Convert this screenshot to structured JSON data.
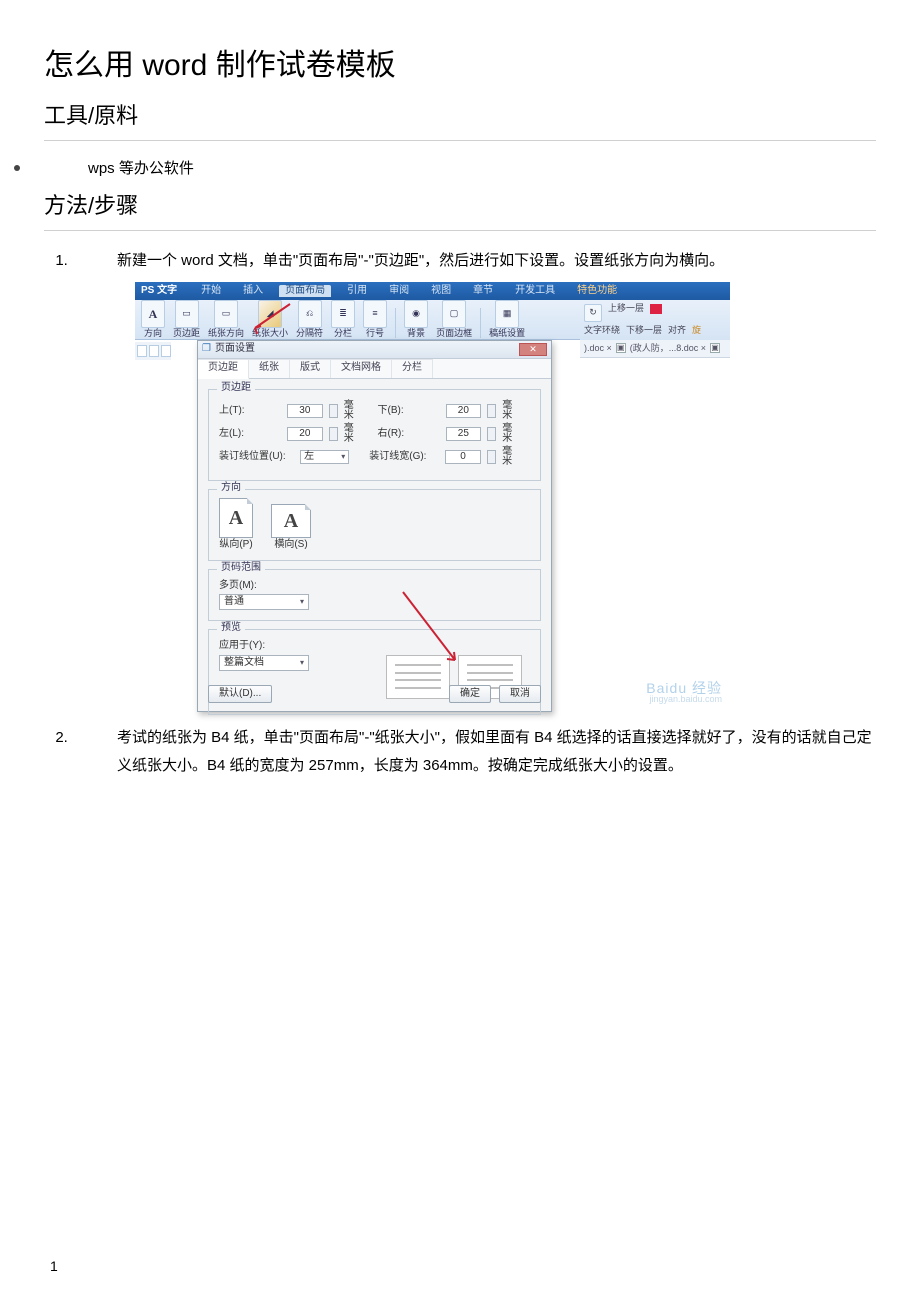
{
  "title": "怎么用 word 制作试卷模板",
  "sections": {
    "tools_head": "工具/原料",
    "tools_item": "wps 等办公软件",
    "steps_head": "方法/步骤"
  },
  "steps": {
    "s1": "新建一个 word 文档，单击\"页面布局\"-\"页边距\"，然后进行如下设置。设置纸张方向为横向。",
    "s2": "考试的纸张为 B4 纸，单击\"页面布局\"-\"纸张大小\"，假如里面有 B4 纸选择的话直接选择就好了，没有的话就自己定义纸张大小。B4 纸的宽度为 257mm，长度为 364mm。按确定完成纸张大小的设置。"
  },
  "ribbon": {
    "app": "PS 文字",
    "tabs": [
      "开始",
      "插入",
      "页面布局",
      "引用",
      "审阅",
      "视图",
      "章节",
      "开发工具",
      "特色功能"
    ],
    "active_tab": "页面布局",
    "groups": [
      "方向",
      "页边距",
      "纸张方向",
      "纸张大小",
      "分隔符",
      "分栏",
      "行号",
      "背景",
      "页面边框",
      "稿纸设置",
      "文字环绕",
      "上移一层",
      "下移一层",
      "对齐",
      "旋"
    ]
  },
  "doctabs": {
    "left": ").doc ×",
    "mid": "(政人防，...8.doc ×"
  },
  "dialog": {
    "title_icon": "❐",
    "title": "页面设置",
    "tabs": [
      "页边距",
      "纸张",
      "版式",
      "文档网格",
      "分栏"
    ],
    "active_tab": "页边距",
    "group_margin": "页边距",
    "top_lbl": "上(T):",
    "top_val": "30",
    "bottom_lbl": "下(B):",
    "bottom_val": "20",
    "left_lbl": "左(L):",
    "left_val": "20",
    "right_lbl": "右(R):",
    "right_val": "25",
    "unit": "毫米",
    "gutpos_lbl": "装订线位置(U):",
    "gutpos_val": "左",
    "gutw_lbl": "装订线宽(G):",
    "gutw_val": "0",
    "group_orient": "方向",
    "orient_portrait": "纵向(P)",
    "orient_landscape": "横向(S)",
    "group_range": "页码范围",
    "multi_lbl": "多页(M):",
    "multi_val": "普通",
    "group_preview": "预览",
    "apply_lbl": "应用于(Y):",
    "apply_val": "整篇文档",
    "default_btn": "默认(D)...",
    "ok_btn": "确定",
    "cancel_btn": "取消"
  },
  "watermark": {
    "main": "Baidu 经验",
    "sub": "jingyan.baidu.com"
  },
  "page_number": "1"
}
